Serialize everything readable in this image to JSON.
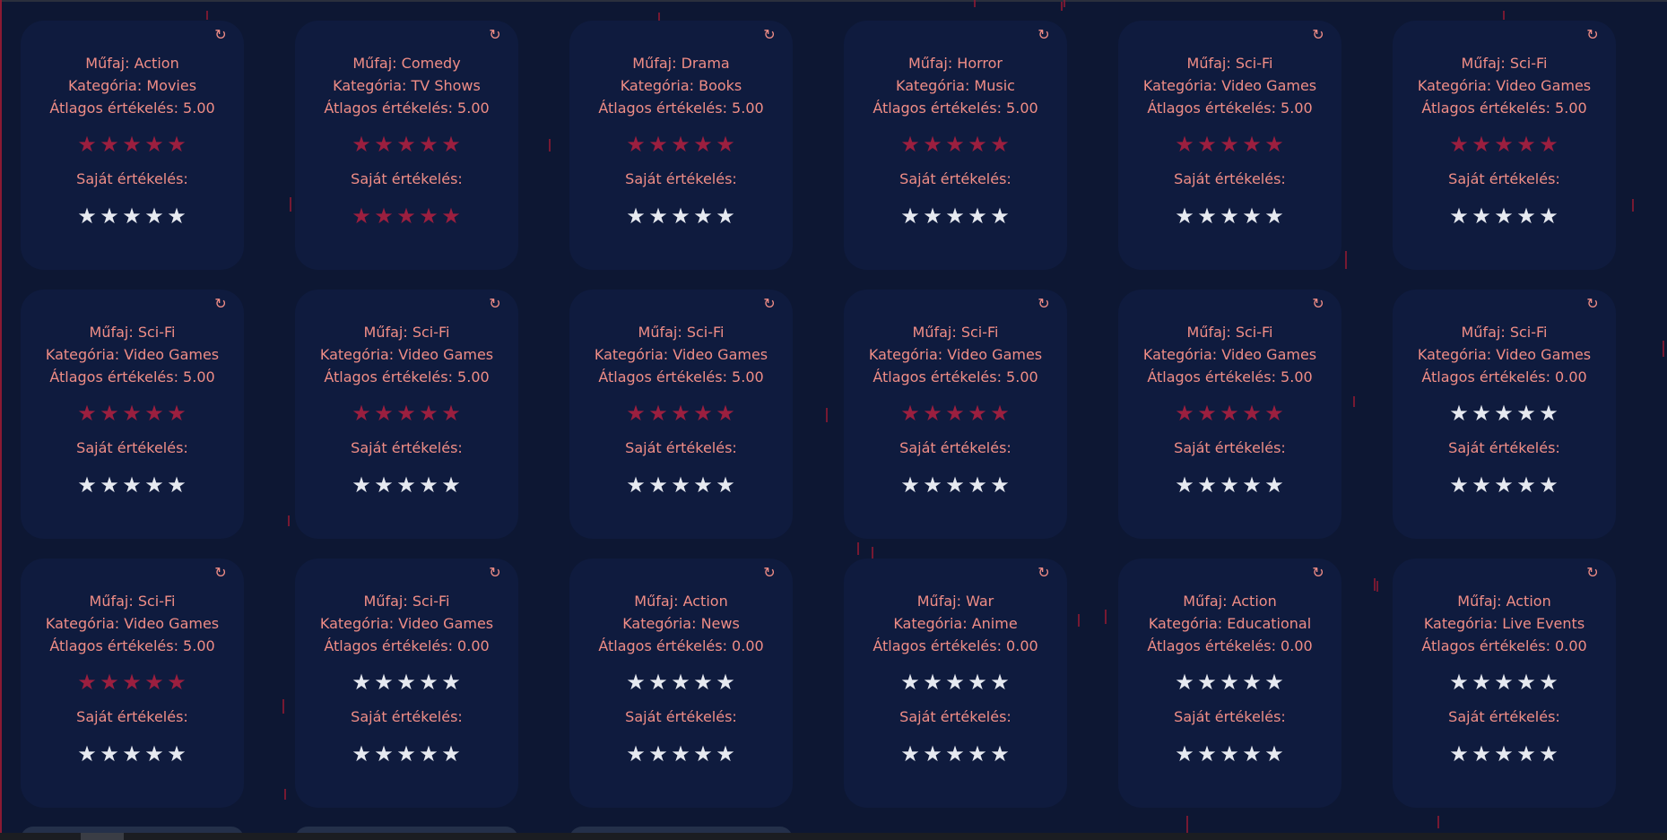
{
  "labels": {
    "genre_prefix": "Műfaj: ",
    "category_prefix": "Kategória: ",
    "average_prefix": "Átlagos értékelés: ",
    "own_rating_label": "Saját értékelés:"
  },
  "icons": {
    "refresh": "refresh-icon",
    "star": "star-icon"
  },
  "colors": {
    "background": "#0d1733",
    "card": "#0f1b3e",
    "text": "#f08d86",
    "star_filled": "#9b1f3f",
    "star_empty": "#e6e9f0"
  },
  "cards": [
    {
      "genre": "Action",
      "category": "Movies",
      "average": "5.00",
      "avg_stars": 5,
      "own_stars": 0
    },
    {
      "genre": "Comedy",
      "category": "TV Shows",
      "average": "5.00",
      "avg_stars": 5,
      "own_stars": 5
    },
    {
      "genre": "Drama",
      "category": "Books",
      "average": "5.00",
      "avg_stars": 5,
      "own_stars": 0
    },
    {
      "genre": "Horror",
      "category": "Music",
      "average": "5.00",
      "avg_stars": 5,
      "own_stars": 0
    },
    {
      "genre": "Sci-Fi",
      "category": "Video Games",
      "average": "5.00",
      "avg_stars": 5,
      "own_stars": 0
    },
    {
      "genre": "Sci-Fi",
      "category": "Video Games",
      "average": "5.00",
      "avg_stars": 5,
      "own_stars": 0
    },
    {
      "genre": "Sci-Fi",
      "category": "Video Games",
      "average": "5.00",
      "avg_stars": 5,
      "own_stars": 0
    },
    {
      "genre": "Sci-Fi",
      "category": "Video Games",
      "average": "5.00",
      "avg_stars": 5,
      "own_stars": 0
    },
    {
      "genre": "Sci-Fi",
      "category": "Video Games",
      "average": "5.00",
      "avg_stars": 5,
      "own_stars": 0
    },
    {
      "genre": "Sci-Fi",
      "category": "Video Games",
      "average": "5.00",
      "avg_stars": 5,
      "own_stars": 0
    },
    {
      "genre": "Sci-Fi",
      "category": "Video Games",
      "average": "5.00",
      "avg_stars": 5,
      "own_stars": 0
    },
    {
      "genre": "Sci-Fi",
      "category": "Video Games",
      "average": "0.00",
      "avg_stars": 0,
      "own_stars": 0
    },
    {
      "genre": "Sci-Fi",
      "category": "Video Games",
      "average": "5.00",
      "avg_stars": 5,
      "own_stars": 0
    },
    {
      "genre": "Sci-Fi",
      "category": "Video Games",
      "average": "0.00",
      "avg_stars": 0,
      "own_stars": 0
    },
    {
      "genre": "Action",
      "category": "News",
      "average": "0.00",
      "avg_stars": 0,
      "own_stars": 0
    },
    {
      "genre": "War",
      "category": "Anime",
      "average": "0.00",
      "avg_stars": 0,
      "own_stars": 0
    },
    {
      "genre": "Action",
      "category": "Educational",
      "average": "0.00",
      "avg_stars": 0,
      "own_stars": 0
    },
    {
      "genre": "Action",
      "category": "Live Events",
      "average": "0.00",
      "avg_stars": 0,
      "own_stars": 0
    }
  ]
}
